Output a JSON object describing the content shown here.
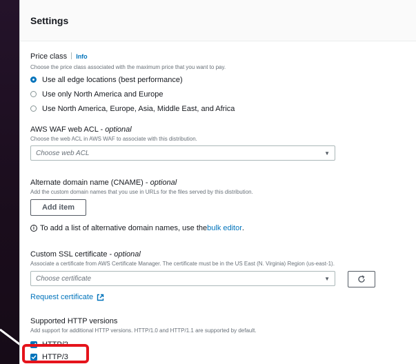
{
  "panel": {
    "title": "Settings"
  },
  "price_class": {
    "label": "Price class",
    "info": "Info",
    "description": "Choose the price class associated with the maximum price that you want to pay.",
    "options": [
      {
        "label": "Use all edge locations (best performance)",
        "selected": true
      },
      {
        "label": "Use only North America and Europe",
        "selected": false
      },
      {
        "label": "Use North America, Europe, Asia, Middle East, and Africa",
        "selected": false
      }
    ]
  },
  "waf": {
    "label": "AWS WAF web ACL - ",
    "optional": "optional",
    "description": "Choose the web ACL in AWS WAF to associate with this distribution.",
    "placeholder": "Choose web ACL"
  },
  "cname": {
    "label": "Alternate domain name (CNAME) - ",
    "optional": "optional",
    "description": "Add the custom domain names that you use in URLs for the files served by this distribution.",
    "add_button": "Add item",
    "note_prefix": "To add a list of alternative domain names, use the ",
    "note_link": "bulk editor",
    "note_suffix": "."
  },
  "ssl": {
    "label": "Custom SSL certificate - ",
    "optional": "optional",
    "description": "Associate a certificate from AWS Certificate Manager. The certificate must be in the US East (N. Virginia) Region (us-east-1).",
    "placeholder": "Choose certificate",
    "request_link": "Request certificate"
  },
  "http_versions": {
    "label": "Supported HTTP versions",
    "description": "Add support for additional HTTP versions. HTTP/1.0 and HTTP/1.1 are supported by default.",
    "options": [
      {
        "label": "HTTP/2",
        "checked": true
      },
      {
        "label": "HTTP/3",
        "checked": true
      }
    ]
  },
  "colors": {
    "accent": "#0073bb",
    "highlight": "#e5131b",
    "text": "#16191f",
    "muted": "#687078"
  }
}
